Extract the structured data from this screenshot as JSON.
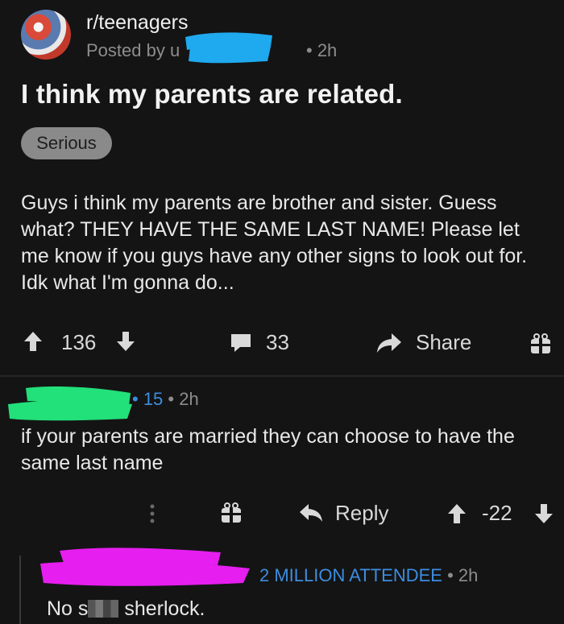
{
  "post": {
    "subreddit": "r/teenagers",
    "posted_by": "Posted by u",
    "time": "• 2h",
    "title": "I think my parents are related.",
    "flair": "Serious",
    "body": "Guys i think my parents are brother and sister. Guess what? THEY HAVE THE SAME LAST NAME! Please let me know if you guys have any other signs to look out for. Idk what I'm gonna do...",
    "votes": "136",
    "comments": "33",
    "share_label": "Share"
  },
  "comment1": {
    "score": "• 15",
    "time": "• 2h",
    "body": "if your parents are married they can choose to have the same last name",
    "reply_label": "Reply",
    "votes": "-22"
  },
  "comment2": {
    "author": "2 MILLION ATTENDEE",
    "time": "• 2h",
    "body_start": "No s",
    "body_end": " sherlock."
  },
  "colors": {
    "background": "#141414",
    "link_blue": "#3d8de0",
    "redact_blue": "#1fa9ef",
    "redact_green": "#22e07a",
    "redact_pink": "#e61ef0"
  }
}
